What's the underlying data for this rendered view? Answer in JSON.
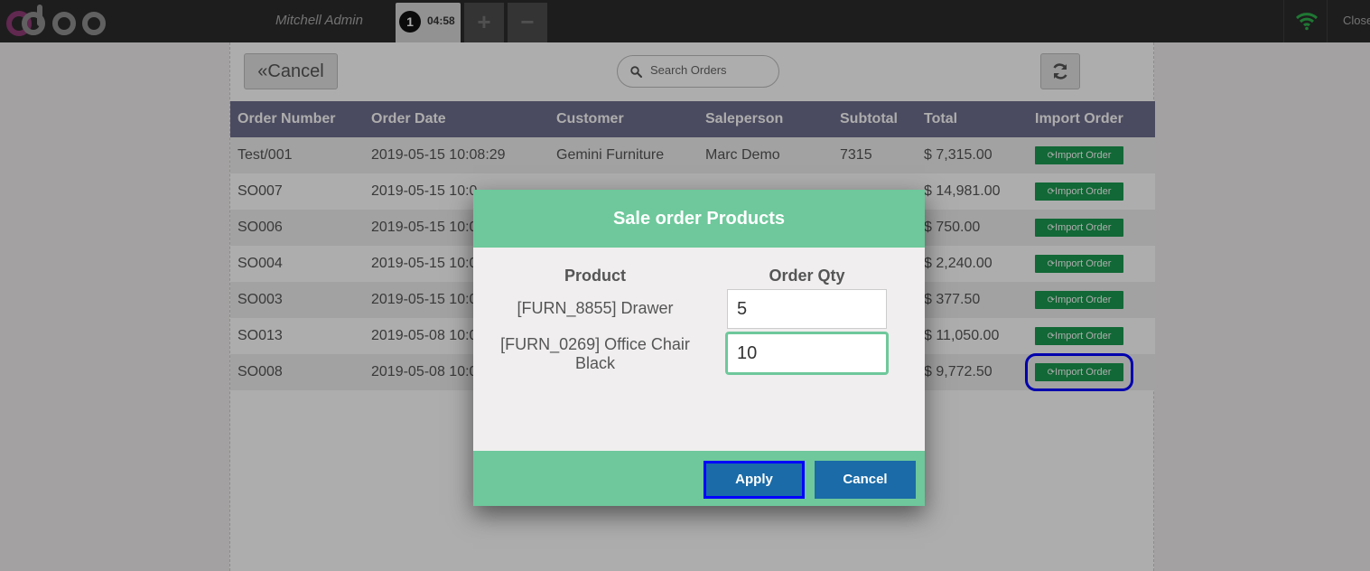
{
  "topbar": {
    "user": "Mitchell Admin",
    "order_number": "1",
    "order_time": "04:58",
    "add_label": "+",
    "remove_label": "−",
    "close_label": "Close"
  },
  "toolbar": {
    "cancel_label": "Cancel",
    "search_placeholder": "Search Orders"
  },
  "table": {
    "headers": [
      "Order Number",
      "Order Date",
      "Customer",
      "Saleperson",
      "Subtotal",
      "Total",
      "Import Order"
    ],
    "import_label": "Import Order",
    "rows": [
      [
        "Test/001",
        "2019-05-15 10:08:29",
        "Gemini Furniture",
        "Marc Demo",
        "7315",
        "$ 7,315.00"
      ],
      [
        "SO007",
        "2019-05-15 10:0",
        "",
        "",
        "",
        "$ 14,981.00"
      ],
      [
        "SO006",
        "2019-05-15 10:0",
        "",
        "",
        "",
        "$ 750.00"
      ],
      [
        "SO004",
        "2019-05-15 10:0",
        "",
        "",
        "",
        "$ 2,240.00"
      ],
      [
        "SO003",
        "2019-05-15 10:0",
        "",
        "",
        "",
        "$ 377.50"
      ],
      [
        "SO013",
        "2019-05-08 10:0",
        "",
        "",
        "",
        "$ 11,050.00"
      ],
      [
        "SO008",
        "2019-05-08 10:0",
        "",
        "",
        "",
        "$ 9,772.50"
      ]
    ]
  },
  "modal": {
    "title": "Sale order Products",
    "product_header": "Product",
    "qty_header": "Order Qty",
    "products": [
      {
        "name": "[FURN_8855] Drawer",
        "qty": "5"
      },
      {
        "name": "[FURN_0269] Office Chair Black",
        "qty": "10"
      }
    ],
    "apply_label": "Apply",
    "cancel_label": "Cancel"
  },
  "colors": {
    "modal_accent": "#6ec89b",
    "table_header": "#6e6e8e",
    "import_button": "#1b9a50",
    "primary_button": "#1a6ba7",
    "highlight": "#0000ff"
  },
  "icons": [
    "odoo-logo",
    "wifi-icon",
    "search-icon",
    "refresh-icon",
    "double-chevron-left-icon"
  ]
}
